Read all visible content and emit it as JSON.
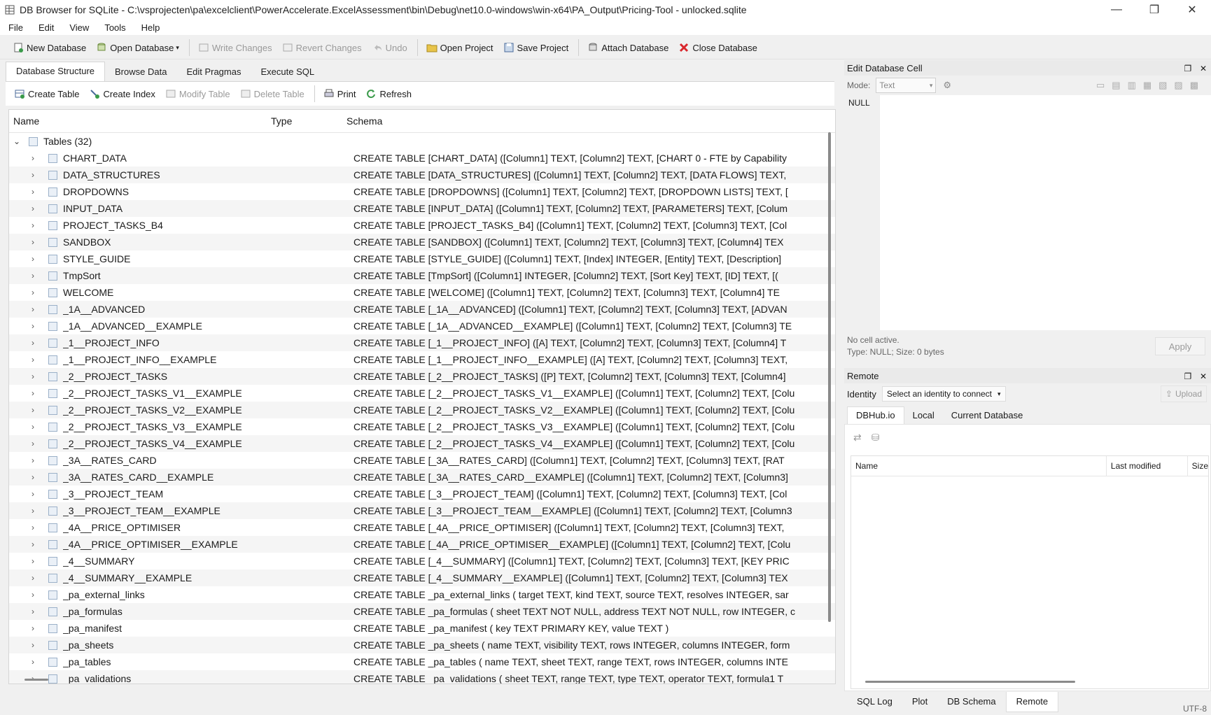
{
  "window": {
    "title": "DB Browser for SQLite - C:\\vsprojecten\\pa\\excelclient\\PowerAccelerate.ExcelAssessment\\bin\\Debug\\net10.0-windows\\win-x64\\PA_Output\\Pricing-Tool - unlocked.sqlite",
    "minimize": "—",
    "maximize": "❐",
    "close": "✕"
  },
  "menu": [
    "File",
    "Edit",
    "View",
    "Tools",
    "Help"
  ],
  "toolbar": {
    "new_db": "New Database",
    "open_db": "Open Database",
    "write": "Write Changes",
    "revert": "Revert Changes",
    "undo": "Undo",
    "open_project": "Open Project",
    "save_project": "Save Project",
    "attach": "Attach Database",
    "close_db": "Close Database"
  },
  "tabs": [
    "Database Structure",
    "Browse Data",
    "Edit Pragmas",
    "Execute SQL"
  ],
  "subtoolbar": {
    "create_table": "Create Table",
    "create_index": "Create Index",
    "modify_table": "Modify Table",
    "delete_table": "Delete Table",
    "print": "Print",
    "refresh": "Refresh"
  },
  "tree": {
    "headers": {
      "name": "Name",
      "type": "Type",
      "schema": "Schema"
    },
    "root_label": "Tables (32)",
    "rows": [
      {
        "name": "CHART_DATA",
        "schema": "CREATE TABLE [CHART_DATA] ([Column1] TEXT, [Column2] TEXT, [CHART 0 - FTE by Capability"
      },
      {
        "name": "DATA_STRUCTURES",
        "schema": "CREATE TABLE [DATA_STRUCTURES] ([Column1] TEXT, [Column2] TEXT, [DATA FLOWS] TEXT,"
      },
      {
        "name": "DROPDOWNS",
        "schema": "CREATE TABLE [DROPDOWNS] ([Column1] TEXT, [Column2] TEXT, [DROPDOWN LISTS] TEXT, ["
      },
      {
        "name": "INPUT_DATA",
        "schema": "CREATE TABLE [INPUT_DATA] ([Column1] TEXT, [Column2] TEXT, [PARAMETERS] TEXT, [Colum"
      },
      {
        "name": "PROJECT_TASKS_B4",
        "schema": "CREATE TABLE [PROJECT_TASKS_B4] ([Column1] TEXT, [Column2] TEXT, [Column3] TEXT, [Col"
      },
      {
        "name": "SANDBOX",
        "schema": "CREATE TABLE [SANDBOX] ([Column1] TEXT, [Column2] TEXT, [Column3] TEXT, [Column4] TEX"
      },
      {
        "name": "STYLE_GUIDE",
        "schema": "CREATE TABLE [STYLE_GUIDE] ([Column1] TEXT, [Index] INTEGER, [Entity] TEXT, [Description]"
      },
      {
        "name": "TmpSort",
        "schema": "CREATE TABLE [TmpSort] ([Column1] INTEGER, [Column2] TEXT, [Sort Key] TEXT, [ID] TEXT, [("
      },
      {
        "name": "WELCOME",
        "schema": "CREATE TABLE [WELCOME] ([Column1] TEXT, [Column2] TEXT, [Column3] TEXT, [Column4] TE"
      },
      {
        "name": "_1A__ADVANCED",
        "schema": "CREATE TABLE [_1A__ADVANCED] ([Column1] TEXT, [Column2] TEXT, [Column3] TEXT, [ADVAN"
      },
      {
        "name": "_1A__ADVANCED__EXAMPLE",
        "schema": "CREATE TABLE [_1A__ADVANCED__EXAMPLE] ([Column1] TEXT, [Column2] TEXT, [Column3] TE"
      },
      {
        "name": "_1__PROJECT_INFO",
        "schema": "CREATE TABLE [_1__PROJECT_INFO] ([A] TEXT, [Column2] TEXT, [Column3] TEXT, [Column4] T"
      },
      {
        "name": "_1__PROJECT_INFO__EXAMPLE",
        "schema": "CREATE TABLE [_1__PROJECT_INFO__EXAMPLE] ([A] TEXT, [Column2] TEXT, [Column3] TEXT,"
      },
      {
        "name": "_2__PROJECT_TASKS",
        "schema": "CREATE TABLE [_2__PROJECT_TASKS] ([P] TEXT, [Column2] TEXT, [Column3] TEXT, [Column4]"
      },
      {
        "name": "_2__PROJECT_TASKS_V1__EXAMPLE",
        "schema": "CREATE TABLE [_2__PROJECT_TASKS_V1__EXAMPLE] ([Column1] TEXT, [Column2] TEXT, [Colu"
      },
      {
        "name": "_2__PROJECT_TASKS_V2__EXAMPLE",
        "schema": "CREATE TABLE [_2__PROJECT_TASKS_V2__EXAMPLE] ([Column1] TEXT, [Column2] TEXT, [Colu"
      },
      {
        "name": "_2__PROJECT_TASKS_V3__EXAMPLE",
        "schema": "CREATE TABLE [_2__PROJECT_TASKS_V3__EXAMPLE] ([Column1] TEXT, [Column2] TEXT, [Colu"
      },
      {
        "name": "_2__PROJECT_TASKS_V4__EXAMPLE",
        "schema": "CREATE TABLE [_2__PROJECT_TASKS_V4__EXAMPLE] ([Column1] TEXT, [Column2] TEXT, [Colu"
      },
      {
        "name": "_3A__RATES_CARD",
        "schema": "CREATE TABLE [_3A__RATES_CARD] ([Column1] TEXT, [Column2] TEXT, [Column3] TEXT, [RAT"
      },
      {
        "name": "_3A__RATES_CARD__EXAMPLE",
        "schema": "CREATE TABLE [_3A__RATES_CARD__EXAMPLE] ([Column1] TEXT, [Column2] TEXT, [Column3]"
      },
      {
        "name": "_3__PROJECT_TEAM",
        "schema": "CREATE TABLE [_3__PROJECT_TEAM] ([Column1] TEXT, [Column2] TEXT, [Column3] TEXT, [Col"
      },
      {
        "name": "_3__PROJECT_TEAM__EXAMPLE",
        "schema": "CREATE TABLE [_3__PROJECT_TEAM__EXAMPLE] ([Column1] TEXT, [Column2] TEXT, [Column3"
      },
      {
        "name": "_4A__PRICE_OPTIMISER",
        "schema": "CREATE TABLE [_4A__PRICE_OPTIMISER] ([Column1] TEXT, [Column2] TEXT, [Column3] TEXT,"
      },
      {
        "name": "_4A__PRICE_OPTIMISER__EXAMPLE",
        "schema": "CREATE TABLE [_4A__PRICE_OPTIMISER__EXAMPLE] ([Column1] TEXT, [Column2] TEXT, [Colu"
      },
      {
        "name": "_4__SUMMARY",
        "schema": "CREATE TABLE [_4__SUMMARY] ([Column1] TEXT, [Column2] TEXT, [Column3] TEXT, [KEY PRIC"
      },
      {
        "name": "_4__SUMMARY__EXAMPLE",
        "schema": "CREATE TABLE [_4__SUMMARY__EXAMPLE] ([Column1] TEXT, [Column2] TEXT, [Column3] TEX"
      },
      {
        "name": "_pa_external_links",
        "schema": "CREATE TABLE _pa_external_links ( target TEXT, kind TEXT, source TEXT, resolves INTEGER, sar"
      },
      {
        "name": "_pa_formulas",
        "schema": "CREATE TABLE _pa_formulas ( sheet TEXT NOT NULL, address TEXT NOT NULL, row INTEGER, c"
      },
      {
        "name": "_pa_manifest",
        "schema": "CREATE TABLE _pa_manifest ( key TEXT PRIMARY KEY, value TEXT )"
      },
      {
        "name": "_pa_sheets",
        "schema": "CREATE TABLE _pa_sheets ( name TEXT, visibility TEXT, rows INTEGER, columns INTEGER, form"
      },
      {
        "name": "_pa_tables",
        "schema": "CREATE TABLE _pa_tables ( name TEXT, sheet TEXT, range TEXT, rows INTEGER, columns INTE"
      },
      {
        "name": "_pa_validations",
        "schema": "CREATE TABLE _pa_validations ( sheet TEXT, range TEXT, type TEXT, operator TEXT, formula1 T"
      }
    ]
  },
  "edit_cell": {
    "title": "Edit Database Cell",
    "mode_label": "Mode:",
    "mode_value": "Text",
    "null_text": "NULL",
    "status_line1": "No cell active.",
    "status_line2": "Type: NULL; Size: 0 bytes",
    "apply": "Apply"
  },
  "remote": {
    "title": "Remote",
    "identity_label": "Identity",
    "identity_value": "Select an identity to connect",
    "upload": "Upload",
    "tabs": [
      "DBHub.io",
      "Local",
      "Current Database"
    ],
    "cols": [
      "Name",
      "Last modified",
      "Size"
    ]
  },
  "bottom_tabs": [
    "SQL Log",
    "Plot",
    "DB Schema",
    "Remote"
  ],
  "status": {
    "encoding": "UTF-8"
  },
  "colors": {
    "accent": "#3b73b9",
    "close_red": "#d9262c",
    "green": "#3a9a4a"
  }
}
